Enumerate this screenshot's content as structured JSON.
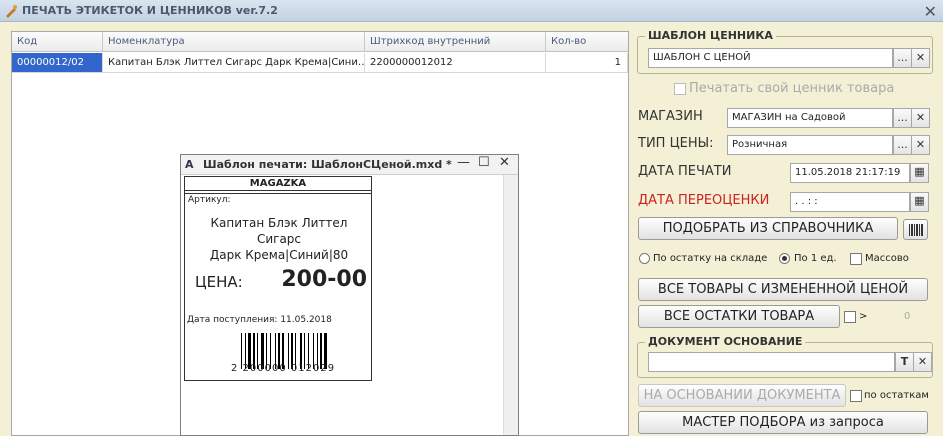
{
  "window": {
    "title": "ПЕЧАТЬ ЭТИКЕТОК И ЦЕННИКОВ ver.7.2",
    "icon": "app-icon",
    "close": "✕"
  },
  "grid": {
    "headers": [
      "Код",
      "Номенклатура",
      "Штрихкод внутренний",
      "Кол-во"
    ],
    "rows": [
      {
        "code": "00000012/02",
        "name": "Капитан Блэк Литтел Сигарс Дарк Крема|Сини…",
        "barcode": "2200000012012",
        "qty": "1"
      }
    ]
  },
  "template_frame": {
    "title": "ШАБЛОН ЦЕННИКА",
    "value": "ШАБЛОН С ЦЕНОЙ",
    "own_tag_label": "Печатать свой ценник товара"
  },
  "store": {
    "label": "МАГАЗИН",
    "value": "МАГАЗИН на Садовой"
  },
  "price_type": {
    "label": "ТИП ЦЕНЫ:",
    "value": "Розничная"
  },
  "print_date": {
    "label": "ДАТА ПЕЧАТИ",
    "value": "11.05.2018 21:17:19"
  },
  "reprice_date": {
    "label": "ДАТА ПЕРЕОЦЕНКИ",
    "value": " .  .    :  :  "
  },
  "buttons": {
    "pick_from_catalog": "ПОДОБРАТЬ ИЗ СПРАВОЧНИКА",
    "all_changed_price": "ВСЕ ТОВАРЫ С ИЗМЕНЕННОЙ ЦЕНОЙ",
    "all_stock": "ВСЕ ОСТАТКИ ТОВАРА",
    "by_document": "НА ОСНОВАНИИ ДОКУМЕНТА",
    "query_wizard": "МАСТЕР ПОДБОРА из запроса",
    "ellipsis": "...",
    "clear": "✕",
    "text_t": "T"
  },
  "options": {
    "by_stock": "По остатку на складе",
    "per_unit": "По 1 ед.",
    "mass": "Массово",
    "selected": "per_unit",
    "gt_sign": ">",
    "gt_value": "0",
    "by_stock_remainders": "по остаткам"
  },
  "base_document": {
    "title": "ДОКУМЕНТ ОСНОВАНИЕ",
    "value": ""
  },
  "popup": {
    "title": "Шаблон печати: ШаблонСЦеной.mxd *",
    "icon_text": "A",
    "minimize": "—",
    "maximize": "☐",
    "close": "✕",
    "card": {
      "store": "MAGAZKA",
      "article_label": "Артикул:",
      "name_line1": "Капитан Блэк Литтел Сигарс",
      "name_line2": "Дарк Крема|Синий|80",
      "price_label": "ЦЕНА:",
      "price_value": "200-00",
      "arrival_label": "Дата поступления:",
      "arrival_date": "11.05.2018",
      "barcode_digits": "2 200000 012029"
    }
  }
}
